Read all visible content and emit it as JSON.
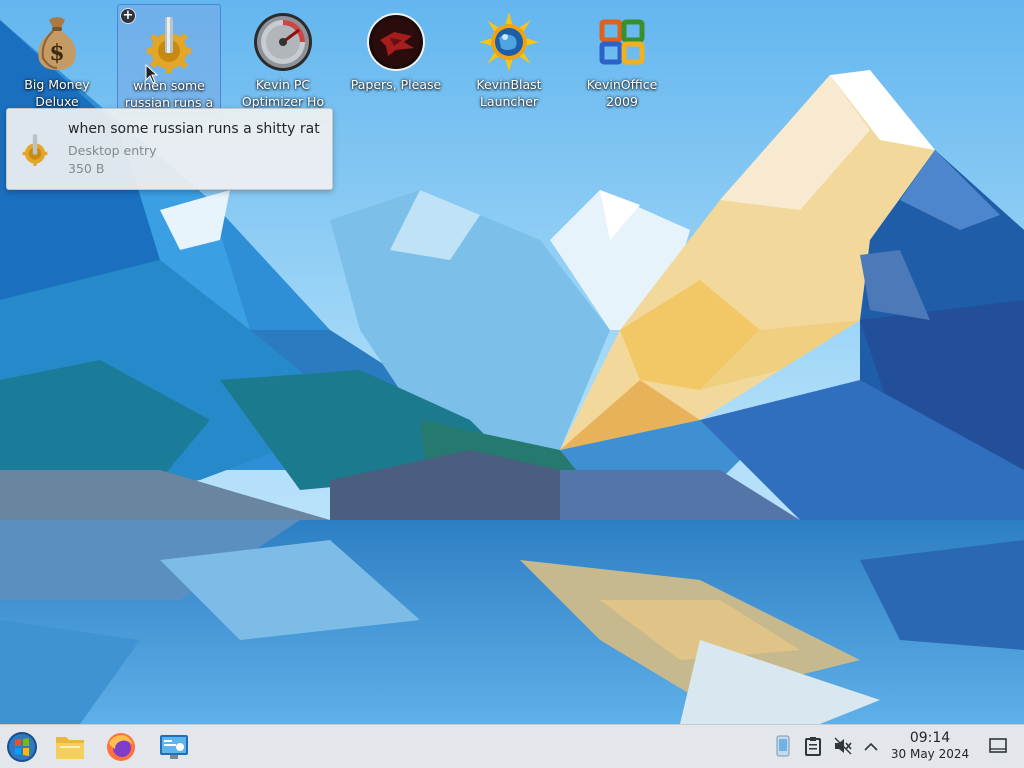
{
  "desktop": {
    "icons": [
      {
        "name": "big-money-deluxe",
        "label": "Big Money\nDeluxe",
        "icon": "money-bag-icon"
      },
      {
        "name": "russian-rat",
        "label": "when some\nrussian runs a",
        "icon": "gear-icon",
        "selected": true
      },
      {
        "name": "kevin-pc-optimizer",
        "label": "Kevin PC\nOptimizer Ho",
        "icon": "gauge-icon"
      },
      {
        "name": "papers-please",
        "label": "Papers, Please",
        "icon": "papers-please-emblem-icon"
      },
      {
        "name": "kevinblast-launcher",
        "label": "KevinBlast\nLauncher",
        "icon": "sun-globe-icon"
      },
      {
        "name": "kevinoffice-2009",
        "label": "KevinOffice\n2009",
        "icon": "office-logo-icon"
      }
    ]
  },
  "tooltip": {
    "title": "when some russian runs a shitty rat",
    "subtitle": "Desktop entry",
    "size": "350 B",
    "icon": "gear-icon"
  },
  "taskbar": {
    "launcher_icon": "start-orb-icon",
    "pinned": [
      {
        "name": "file-manager",
        "icon": "folder-icon"
      },
      {
        "name": "firefox",
        "icon": "firefox-icon"
      },
      {
        "name": "system-settings",
        "icon": "monitor-settings-icon"
      }
    ],
    "tray": [
      {
        "name": "notifier",
        "icon": "phone-notifier-icon"
      },
      {
        "name": "clipboard",
        "icon": "clipboard-icon"
      },
      {
        "name": "volume",
        "icon": "volume-muted-icon"
      },
      {
        "name": "expand",
        "icon": "chevron-up-icon"
      }
    ],
    "clock": {
      "time": "09:14",
      "date": "30 May 2024"
    },
    "show_desktop_icon": "show-desktop-icon"
  },
  "colors": {
    "selection_bg": "#78aae6",
    "taskbar_bg": "#e3e6ea",
    "tooltip_bg": "#eff0f1",
    "clock_text": "#232629"
  }
}
